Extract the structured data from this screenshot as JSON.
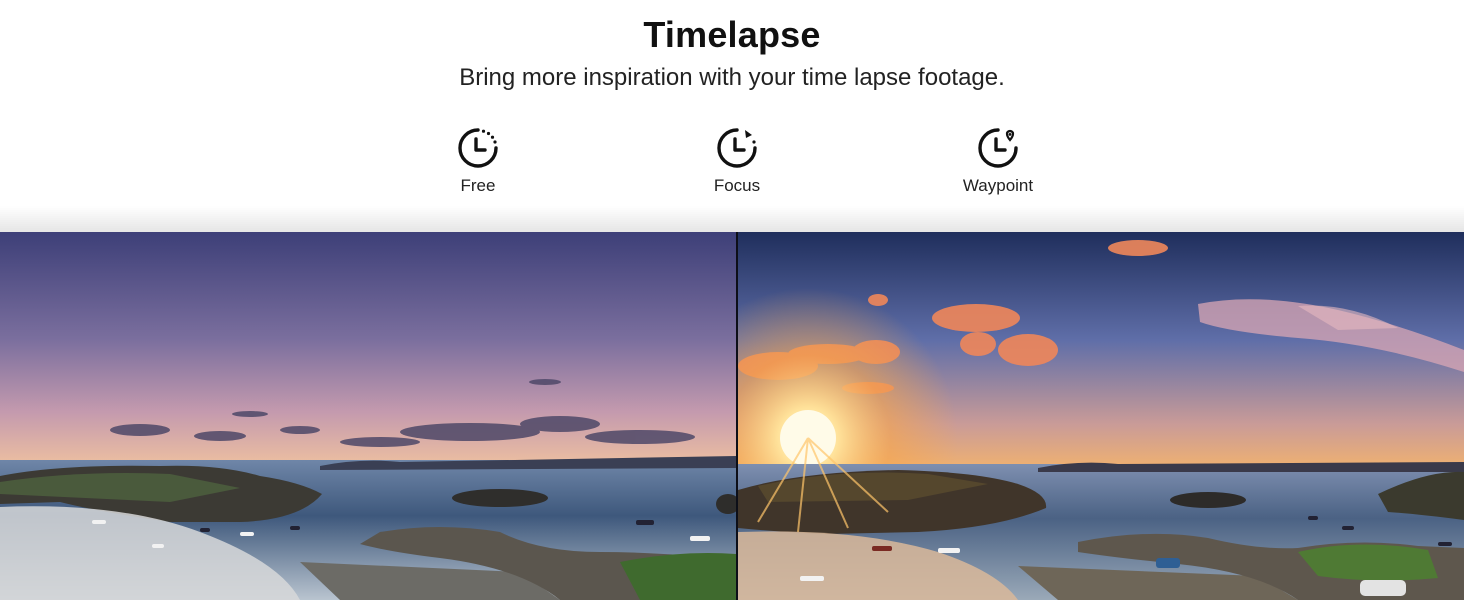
{
  "section": {
    "title": "Timelapse",
    "subtitle": "Bring more inspiration with your time lapse footage."
  },
  "modes": [
    {
      "label": "Free",
      "icon": "timer-free-icon"
    },
    {
      "label": "Focus",
      "icon": "timer-focus-icon"
    },
    {
      "label": "Waypoint",
      "icon": "timer-waypoint-icon"
    }
  ],
  "photos": [
    {
      "name": "dusk-coastline-photo"
    },
    {
      "name": "sunset-coastline-photo"
    }
  ],
  "colors": {
    "text": "#111111",
    "dusk_sky_top": "#3d3f78",
    "sunset_sky_top": "#1f2e5c",
    "sun": "#ffd98a"
  }
}
